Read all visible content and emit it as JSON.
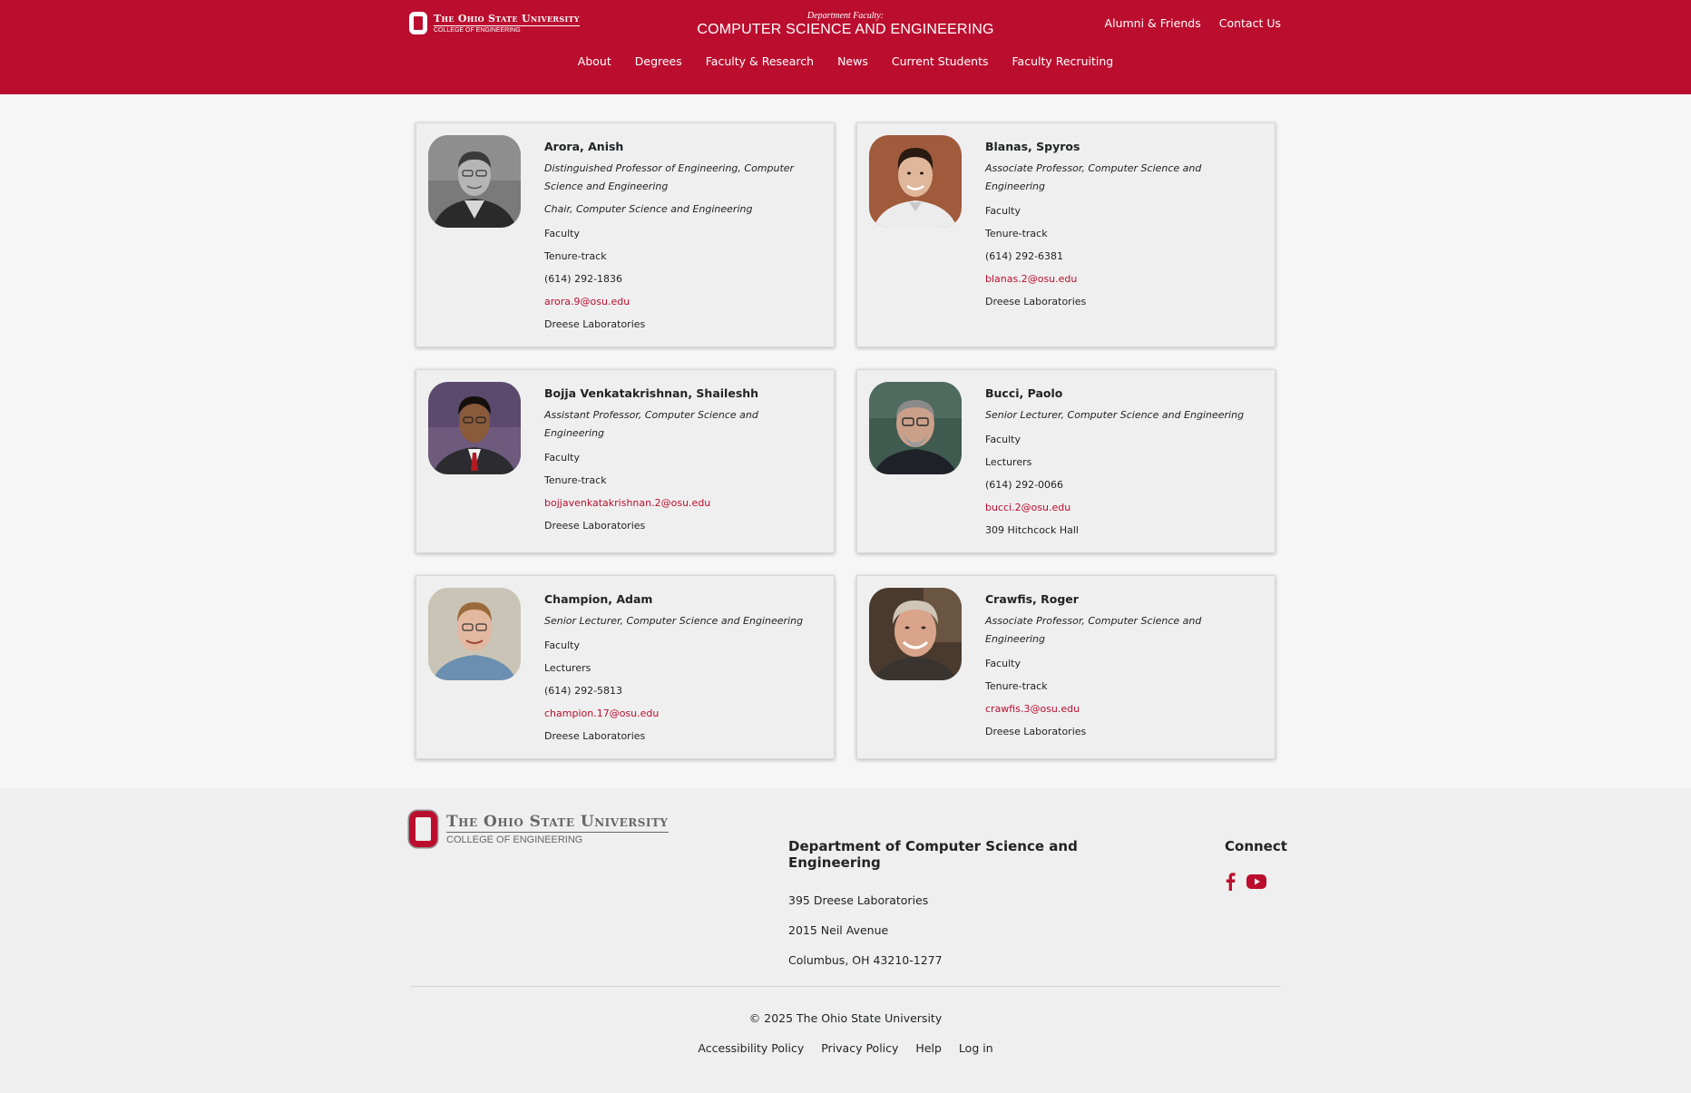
{
  "header": {
    "logo_main": "The Ohio State University",
    "logo_sub": "College of Engineering",
    "dept_label": "Department Faculty:",
    "dept_name": "COMPUTER SCIENCE AND ENGINEERING",
    "util_nav": [
      "Alumni & Friends",
      "Contact Us"
    ],
    "main_nav": [
      "About",
      "Degrees",
      "Faculty & Research",
      "News",
      "Current Students",
      "Faculty Recruiting"
    ]
  },
  "faculty": [
    {
      "name": "Arora, Anish",
      "titles": [
        "Distinguished Professor of Engineering, Computer Science and Engineering",
        "Chair, Computer Science and Engineering"
      ],
      "type": "Faculty",
      "track": "Tenure-track",
      "phone": "(614) 292-1836",
      "email": "arora.9@osu.edu",
      "office": "Dreese Laboratories"
    },
    {
      "name": "Blanas, Spyros",
      "titles": [
        "Associate Professor, Computer Science and Engineering"
      ],
      "type": "Faculty",
      "track": "Tenure-track",
      "phone": "(614) 292-6381",
      "email": "blanas.2@osu.edu",
      "office": "Dreese Laboratories"
    },
    {
      "name": "Bojja Venkatakrishnan, Shaileshh",
      "titles": [
        "Assistant Professor, Computer Science and Engineering"
      ],
      "type": "Faculty",
      "track": "Tenure-track",
      "phone": "",
      "email": "bojjavenkatakrishnan.2@osu.edu",
      "office": "Dreese Laboratories"
    },
    {
      "name": "Bucci, Paolo",
      "titles": [
        "Senior Lecturer, Computer Science and Engineering"
      ],
      "type": "Faculty",
      "track": "Lecturers",
      "phone": "(614) 292-0066",
      "email": "bucci.2@osu.edu",
      "office": "309 Hitchcock Hall"
    },
    {
      "name": "Champion, Adam",
      "titles": [
        "Senior Lecturer, Computer Science and Engineering"
      ],
      "type": "Faculty",
      "track": "Lecturers",
      "phone": "(614) 292-5813",
      "email": "champion.17@osu.edu",
      "office": "Dreese Laboratories"
    },
    {
      "name": "Crawfis, Roger",
      "titles": [
        "Associate Professor, Computer Science and Engineering"
      ],
      "type": "Faculty",
      "track": "Tenure-track",
      "phone": "",
      "email": "crawfis.3@osu.edu",
      "office": "Dreese Laboratories"
    }
  ],
  "footer": {
    "logo_main": "The Ohio State University",
    "logo_sub": "College of Engineering",
    "dept_heading": "Department of Computer Science and Engineering",
    "address": [
      "395 Dreese Laboratories",
      "2015 Neil Avenue",
      "Columbus, OH 43210-1277"
    ],
    "connect_heading": "Connect",
    "social_icons": [
      "facebook-icon",
      "youtube-icon"
    ],
    "copyright": "© 2025 The Ohio State University",
    "legal_links": [
      "Accessibility Policy",
      "Privacy Policy",
      "Help",
      "Log in"
    ]
  },
  "colors": {
    "scarlet": "#bb0e2f",
    "page_bg": "#f6f6f6",
    "card_bg": "#efefef",
    "text": "#212325"
  }
}
